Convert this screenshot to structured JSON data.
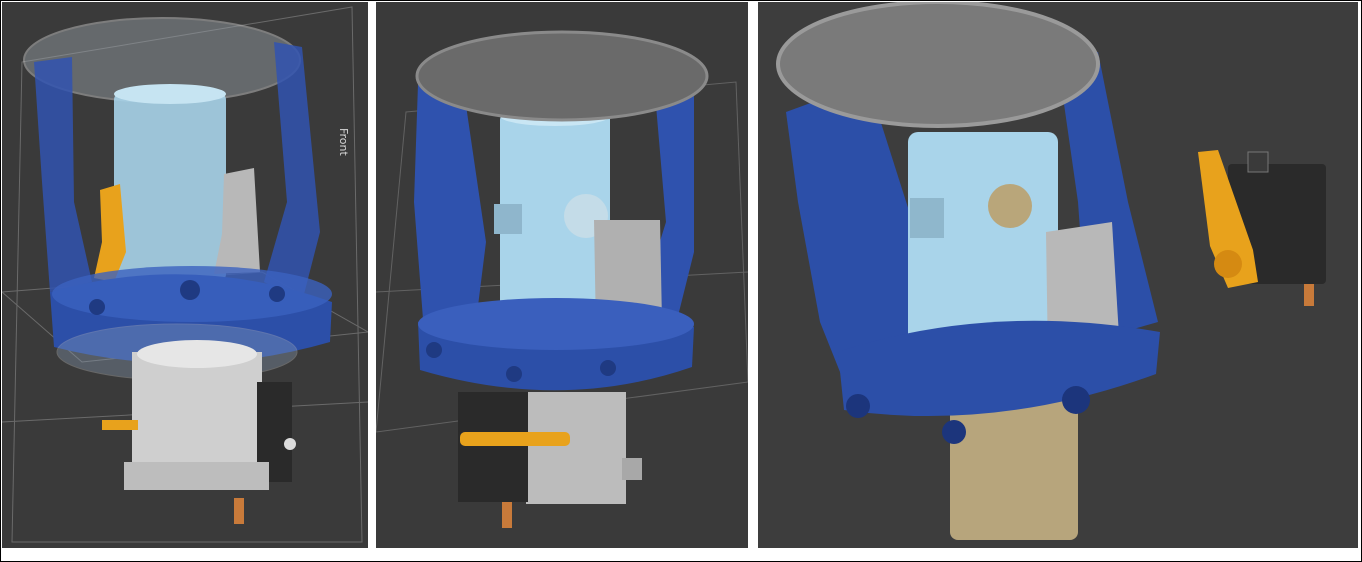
{
  "panels": [
    {
      "id": "cad-view-transparent",
      "view_label": "Front"
    },
    {
      "id": "cad-view-assembly"
    },
    {
      "id": "cad-view-rendered"
    }
  ],
  "colors": {
    "background": "#3a3a3a",
    "housing_blue": "#2c4fa8",
    "tube_lightblue": "#a9d4ea",
    "lid_gray": "#6a6a6a",
    "servo_black": "#2a2a2a",
    "arm_orange": "#e8a21c",
    "lower_tube_tan": "#b7a57c",
    "bracket_gray": "#b8b8b8"
  }
}
